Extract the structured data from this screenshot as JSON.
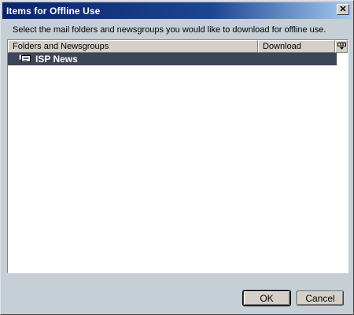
{
  "window": {
    "title": "Items for Offline Use",
    "close_label": "✕"
  },
  "instruction": "Select the mail folders and newsgroups you would like to download for offline use.",
  "listview": {
    "columns": [
      {
        "label": "Folders and Newsgroups"
      },
      {
        "label": "Download"
      }
    ],
    "rows": [
      {
        "label": "ISP News",
        "icon": "newsgroup-icon",
        "selected": true
      }
    ]
  },
  "buttons": {
    "ok_label": "OK",
    "cancel_label": "Cancel"
  },
  "colors": {
    "title_bar_start": "#0a246a",
    "title_bar_end": "#a6caf0",
    "dialog_background": "#c6ced6",
    "selected_row": "#3c4658"
  }
}
